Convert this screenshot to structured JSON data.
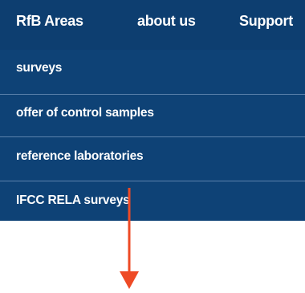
{
  "nav": {
    "items": [
      {
        "label": "RfB Areas"
      },
      {
        "label": "about us"
      },
      {
        "label": "Support"
      }
    ],
    "color": "#0d3e70"
  },
  "dropdown": {
    "items": [
      {
        "label": "surveys"
      },
      {
        "label": "offer of control samples"
      },
      {
        "label": "reference laboratories"
      },
      {
        "label": "IFCC RELA surveys"
      }
    ],
    "color": "#0e4276"
  },
  "annotation": {
    "arrow_color": "#ee4a25",
    "arrow_icon": "down-arrow-annotation"
  }
}
